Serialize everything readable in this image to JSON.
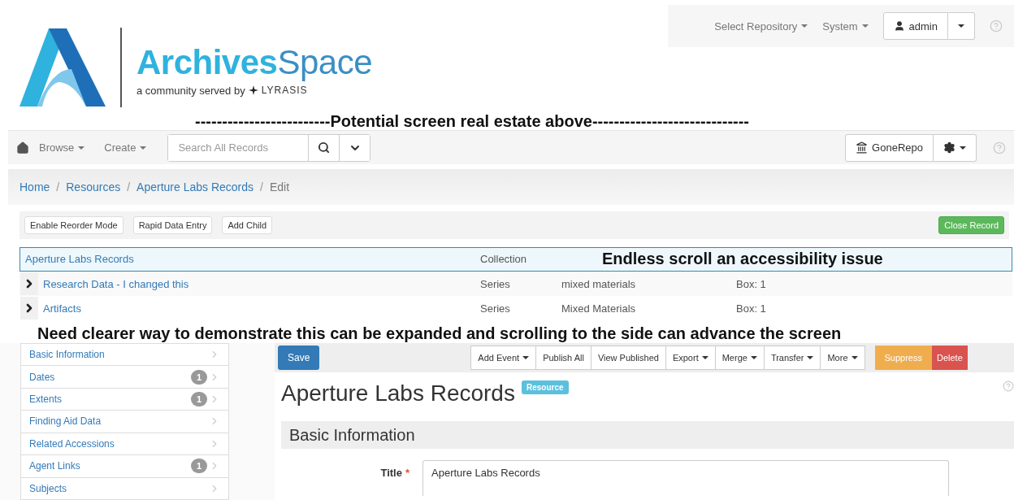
{
  "header": {
    "brand_bold": "Archives",
    "brand_light": "Space",
    "tagline": "a community served by",
    "partner": "LYRASIS"
  },
  "top_menu": {
    "items": [
      {
        "label": "Select Repository"
      },
      {
        "label": "System"
      }
    ],
    "user": "admin"
  },
  "annotation_top": "-------------------------Potential screen real estate above-----------------------------",
  "navbar": {
    "items": [
      {
        "label": "Browse"
      },
      {
        "label": "Create"
      }
    ],
    "search": {
      "placeholder": "Search All Records"
    },
    "repository": "GoneRepo"
  },
  "breadcrumb": [
    "Home",
    "Resources",
    "Aperture Labs Records",
    "Edit"
  ],
  "breadcrumb_separator": "/",
  "tree_toolbar": {
    "buttons": [
      "Enable Reorder Mode",
      "Rapid Data Entry",
      "Add Child"
    ],
    "close_button": "Close Record"
  },
  "tree": {
    "annotation": "Endless scroll an accessibility issue",
    "rows": [
      {
        "title": "Aperture Labs Records",
        "record_type": "Collection",
        "selected": true,
        "expandable": false
      },
      {
        "title": "Research Data - I changed this",
        "record_type": "Series",
        "extent": "mixed materials",
        "container": "Box: 1",
        "selected": false,
        "expandable": true
      },
      {
        "title": "Artifacts",
        "record_type": "Series",
        "extent": "Mixed Materials",
        "container": "Box: 1",
        "selected": false,
        "expandable": true
      }
    ]
  },
  "annotation_bottom": "Need clearer way to demonstrate this can be expanded and scrolling to the side can advance the screen",
  "sidebar": [
    {
      "label": "Basic Information"
    },
    {
      "label": "Dates",
      "count": "1"
    },
    {
      "label": "Extents",
      "count": "1"
    },
    {
      "label": "Finding Aid Data"
    },
    {
      "label": "Related Accessions"
    },
    {
      "label": "Agent Links",
      "count": "1"
    },
    {
      "label": "Subjects"
    }
  ],
  "record_toolbar": {
    "save": "Save",
    "buttons": [
      {
        "label": "Add Event",
        "dropdown": true
      },
      {
        "label": "Publish All",
        "dropdown": false
      },
      {
        "label": "View Published",
        "dropdown": false
      },
      {
        "label": "Export",
        "dropdown": true
      },
      {
        "label": "Merge",
        "dropdown": true
      },
      {
        "label": "Transfer",
        "dropdown": true
      },
      {
        "label": "More",
        "dropdown": true
      }
    ],
    "suppress": "Suppress",
    "delete": "Delete"
  },
  "record": {
    "title": "Aperture Labs Records",
    "badge": "Resource",
    "section": "Basic Information",
    "fields": [
      {
        "label": "Title",
        "required": true,
        "required_mark": "*",
        "value": "Aperture Labs Records"
      }
    ]
  }
}
